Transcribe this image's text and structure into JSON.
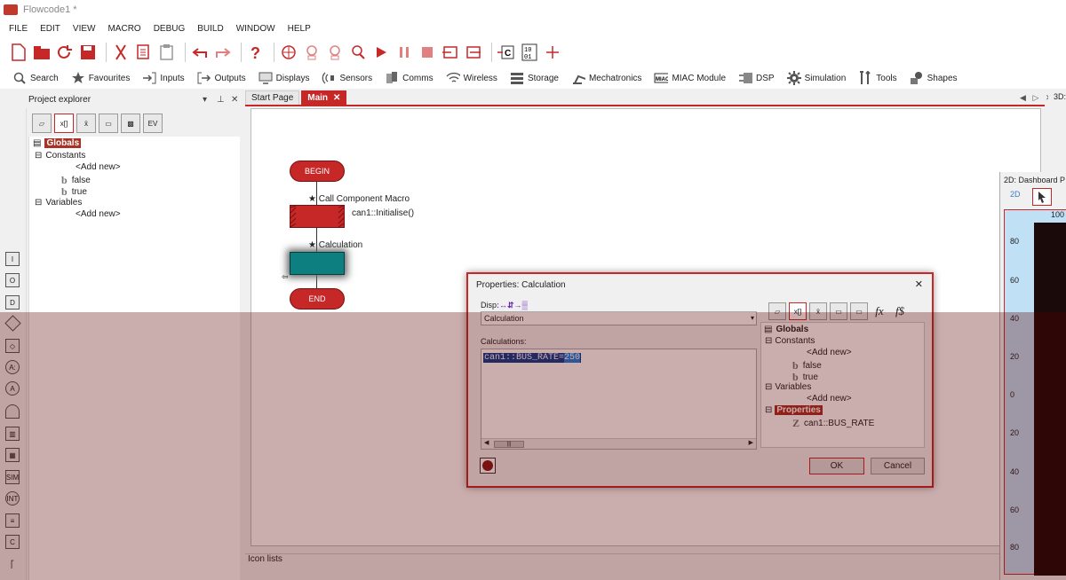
{
  "app": {
    "title": "Flowcode1 *"
  },
  "menu": [
    "FILE",
    "EDIT",
    "VIEW",
    "MACRO",
    "DEBUG",
    "BUILD",
    "WINDOW",
    "HELP"
  ],
  "component_categories": [
    "Search",
    "Favourites",
    "Inputs",
    "Outputs",
    "Displays",
    "Sensors",
    "Comms",
    "Wireless",
    "Storage",
    "Mechatronics",
    "MIAC Module",
    "DSP",
    "Simulation",
    "Tools",
    "Shapes"
  ],
  "project_explorer": {
    "title": "Project explorer",
    "tree": {
      "root": "Globals",
      "constants_label": "Constants",
      "constants_add": "<Add new>",
      "const_false": "false",
      "const_true": "true",
      "variables_label": "Variables",
      "variables_add": "<Add new>"
    }
  },
  "tabs": {
    "start": "Start Page",
    "main": "Main",
    "close": "✕"
  },
  "flowchart": {
    "begin": "BEGIN",
    "macro_title": "Call Component Macro",
    "macro_call": "can1::Initialise()",
    "calc_title": "Calculation",
    "end": "END"
  },
  "bottom_panel": {
    "label": "Icon lists"
  },
  "dashboard": {
    "tab_3d": "3D:",
    "title_2d": "2D: Dashboard P",
    "mode": "2D",
    "ruler_top": "100",
    "ticks": [
      "80",
      "60",
      "40",
      "20",
      "0",
      "20",
      "40",
      "60",
      "80"
    ]
  },
  "dialog": {
    "title": "Properties: Calculation",
    "close": "✕",
    "display_label": "Disp",
    "display_glitch": "ː↔⇵→▒",
    "display_value": "Calculation",
    "calculations_label": "Calculations:",
    "calc_code": "can1::BUS_RATE=",
    "calc_value": "250",
    "tree": {
      "root": "Globals",
      "constants_label": "Constants",
      "constants_add": "<Add new>",
      "const_false": "false",
      "const_true": "true",
      "variables_label": "Variables",
      "variables_add": "<Add new>",
      "properties_label": "Properties",
      "property_item": "can1::BUS_RATE"
    },
    "ok": "OK",
    "cancel": "Cancel"
  },
  "colors": {
    "accent": "#c62828",
    "calc_fill": "#0e7f80",
    "overlay": "#5a0000"
  }
}
